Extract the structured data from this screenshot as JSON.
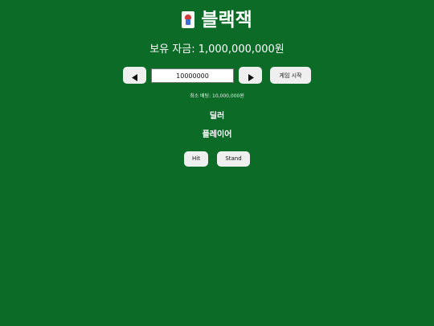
{
  "title": {
    "icon": "joker-card-icon",
    "text": "블랙잭"
  },
  "funds": {
    "label": "보유 자금: 1,000,000,000원"
  },
  "bet": {
    "decrease_icon": "triangle-left-icon",
    "increase_icon": "triangle-right-icon",
    "amount_value": "10000000",
    "start_label": "게임 시작",
    "min_bet_text": "최소 배팅: 10,000,000원"
  },
  "table": {
    "dealer_label": "딜러",
    "player_label": "플레이어"
  },
  "actions": {
    "hit_label": "Hit",
    "stand_label": "Stand"
  },
  "colors": {
    "background": "#0b6b27",
    "button": "#efefef",
    "text": "#ffffff"
  }
}
